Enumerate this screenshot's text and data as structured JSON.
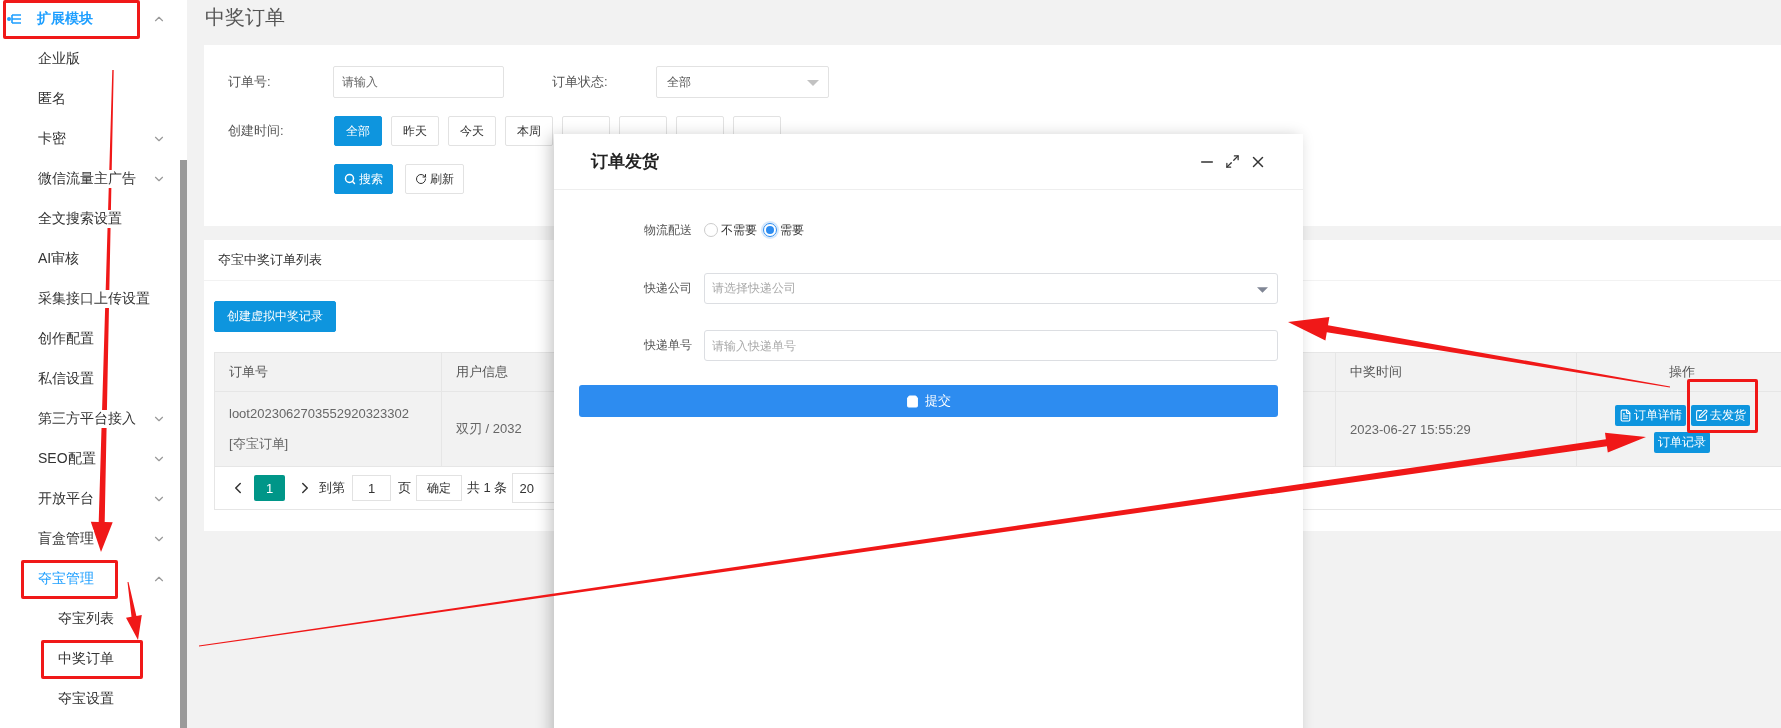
{
  "sidebar": {
    "items": [
      {
        "label": "扩展模块",
        "expanded": true,
        "active": true,
        "highlighted": true,
        "children": [
          {
            "label": "企业版",
            "highlighted": false
          },
          {
            "label": "匿名",
            "highlighted": false
          },
          {
            "label": "卡密",
            "expanded": false,
            "active": false,
            "highlighted": false
          },
          {
            "label": "微信流量主广告",
            "expanded": false,
            "active": false,
            "highlighted": false
          },
          {
            "label": "全文搜索设置",
            "highlighted": false
          },
          {
            "label": "AI审核",
            "highlighted": false
          },
          {
            "label": "采集接口上传设置",
            "highlighted": false
          },
          {
            "label": "创作配置",
            "highlighted": false
          },
          {
            "label": "私信设置",
            "highlighted": false
          },
          {
            "label": "第三方平台接入",
            "expanded": false,
            "active": false,
            "highlighted": false
          },
          {
            "label": "SEO配置",
            "expanded": false,
            "active": false,
            "highlighted": false
          },
          {
            "label": "开放平台",
            "expanded": false,
            "active": false,
            "highlighted": false
          },
          {
            "label": "盲盒管理",
            "expanded": false,
            "active": false,
            "highlighted": false
          },
          {
            "label": "夺宝管理",
            "expanded": true,
            "active": true,
            "highlighted": true,
            "children": [
              {
                "label": "夺宝列表",
                "highlighted": false
              },
              {
                "label": "中奖订单",
                "highlighted": true
              },
              {
                "label": "夺宝设置",
                "highlighted": false
              }
            ]
          }
        ]
      }
    ]
  },
  "page_title": "中奖订单",
  "filters": {
    "order_no": {
      "label": "订单号:",
      "placeholder": "请输入"
    },
    "status": {
      "label": "订单状态:",
      "value": "全部"
    },
    "created": {
      "label": "创建时间:",
      "options": [
        {
          "label": "全部",
          "selected": true
        },
        {
          "label": "昨天",
          "selected": false
        },
        {
          "label": "今天",
          "selected": false
        },
        {
          "label": "本周",
          "selected": false
        },
        {
          "selected": false
        },
        {
          "selected": false
        },
        {
          "selected": false
        },
        {
          "selected": false
        }
      ]
    },
    "search_button": "搜索",
    "refresh_button": "刷新"
  },
  "list": {
    "title": "夺宝中奖订单列表",
    "create_button": "创建虚拟中奖记录",
    "columns": [
      "订单号",
      "用户信息",
      "中奖时间",
      "操作"
    ],
    "rows": [
      {
        "order_no": "loot2023062703552920323302",
        "order_type": "[夺宝订单]",
        "user": "双刃 / 2032",
        "time": "2023-06-27 15:55:29",
        "actions": [
          {
            "kind": "details",
            "label": "订单详情",
            "highlighted": false
          },
          {
            "kind": "ship",
            "label": "去发货",
            "highlighted": true
          },
          {
            "kind": "log",
            "label": "订单记录",
            "highlighted": false
          }
        ]
      }
    ],
    "pagination": {
      "current": "1",
      "goto_label": "到第",
      "goto_value": "1",
      "page_label": "页",
      "confirm": "确定",
      "total": "共 1 条",
      "page_size": "20"
    }
  },
  "dialog": {
    "title": "订单发货",
    "delivery": {
      "label": "物流配送",
      "options": [
        {
          "label": "不需要",
          "selected": false
        },
        {
          "label": "需要",
          "selected": true
        }
      ]
    },
    "courier": {
      "label": "快递公司",
      "placeholder": "请选择快递公司"
    },
    "tracking": {
      "label": "快递单号",
      "placeholder": "请输入快递单号"
    },
    "submit": "提交"
  }
}
